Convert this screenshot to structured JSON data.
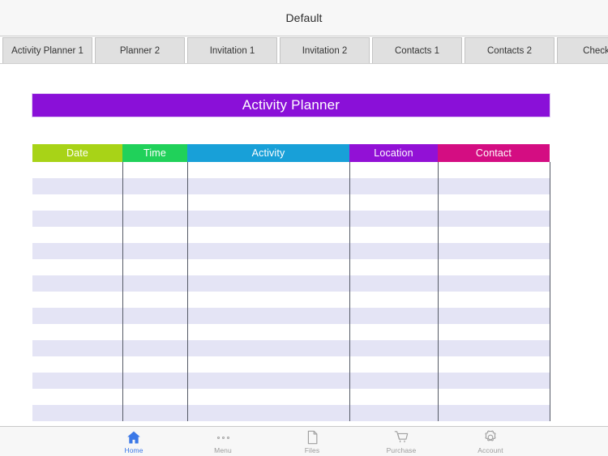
{
  "window": {
    "title": "Default"
  },
  "tabs": [
    {
      "label": "Activity Planner 1",
      "active": true
    },
    {
      "label": "Planner 2",
      "active": false
    },
    {
      "label": "Invitation 1",
      "active": false
    },
    {
      "label": "Invitation 2",
      "active": false
    },
    {
      "label": "Contacts 1",
      "active": false
    },
    {
      "label": "Contacts 2",
      "active": false
    },
    {
      "label": "Checklist",
      "active": false
    }
  ],
  "document": {
    "banner_title": "Activity Planner",
    "banner_color": "#8a10d8",
    "table": {
      "columns": [
        {
          "label": "Date",
          "color": "#a8d317"
        },
        {
          "label": "Time",
          "color": "#20d15a"
        },
        {
          "label": "Activity",
          "color": "#18a0d8"
        },
        {
          "label": "Location",
          "color": "#9211d6"
        },
        {
          "label": "Contact",
          "color": "#d40d82"
        }
      ],
      "row_count": 16,
      "rows": [
        [
          "",
          "",
          "",
          "",
          ""
        ],
        [
          "",
          "",
          "",
          "",
          ""
        ],
        [
          "",
          "",
          "",
          "",
          ""
        ],
        [
          "",
          "",
          "",
          "",
          ""
        ],
        [
          "",
          "",
          "",
          "",
          ""
        ],
        [
          "",
          "",
          "",
          "",
          ""
        ],
        [
          "",
          "",
          "",
          "",
          ""
        ],
        [
          "",
          "",
          "",
          "",
          ""
        ],
        [
          "",
          "",
          "",
          "",
          ""
        ],
        [
          "",
          "",
          "",
          "",
          ""
        ],
        [
          "",
          "",
          "",
          "",
          ""
        ],
        [
          "",
          "",
          "",
          "",
          ""
        ],
        [
          "",
          "",
          "",
          "",
          ""
        ],
        [
          "",
          "",
          "",
          "",
          ""
        ],
        [
          "",
          "",
          "",
          "",
          ""
        ],
        [
          "",
          "",
          "",
          "",
          ""
        ]
      ],
      "stripe_color": "#e4e4f5"
    }
  },
  "bottom_bar": {
    "active_color": "#3b78e7",
    "items": [
      {
        "label": "Home",
        "icon": "home-icon",
        "active": true
      },
      {
        "label": "Menu",
        "icon": "dots-menu-icon",
        "active": false
      },
      {
        "label": "Files",
        "icon": "file-icon",
        "active": false
      },
      {
        "label": "Purchase",
        "icon": "cart-icon",
        "active": false
      },
      {
        "label": "Account",
        "icon": "gear-icon",
        "active": false
      }
    ]
  }
}
